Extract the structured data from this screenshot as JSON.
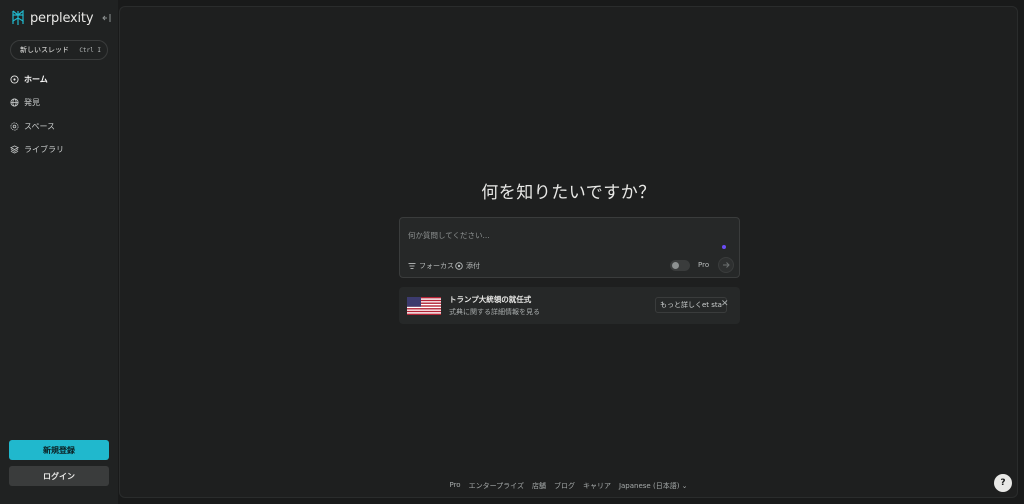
{
  "brand": {
    "name": "perplexity"
  },
  "sidebar": {
    "new_thread_label": "新しいスレッド",
    "new_thread_shortcut": "Ctrl  I",
    "items": [
      {
        "label": "ホーム",
        "icon": "home-icon",
        "active": true
      },
      {
        "label": "発見",
        "icon": "globe-icon",
        "active": false
      },
      {
        "label": "スペース",
        "icon": "spaces-icon",
        "active": false
      },
      {
        "label": "ライブラリ",
        "icon": "library-icon",
        "active": false
      }
    ],
    "signup_label": "新規登録",
    "login_label": "ログイン"
  },
  "main": {
    "headline": "何を知りたいですか？",
    "search": {
      "placeholder": "何か質問してください...",
      "focus_label": "フォーカス",
      "attach_label": "添付",
      "pro_label": "Pro"
    },
    "news_card": {
      "title": "トランプ大統領の就任式",
      "subtitle": "式典に関する詳細情報を見る",
      "more_label": "もっと詳しくet sta"
    }
  },
  "footer": {
    "links": [
      "Pro",
      "エンタープライズ",
      "店舗",
      "ブログ",
      "キャリア",
      "Japanese (日本語) ⌄"
    ]
  },
  "help_label": "?",
  "colors": {
    "accent": "#20b8cd",
    "background": "#191a1a",
    "panel": "#1e1f1f",
    "purple_indicator": "#6a4cf5"
  }
}
